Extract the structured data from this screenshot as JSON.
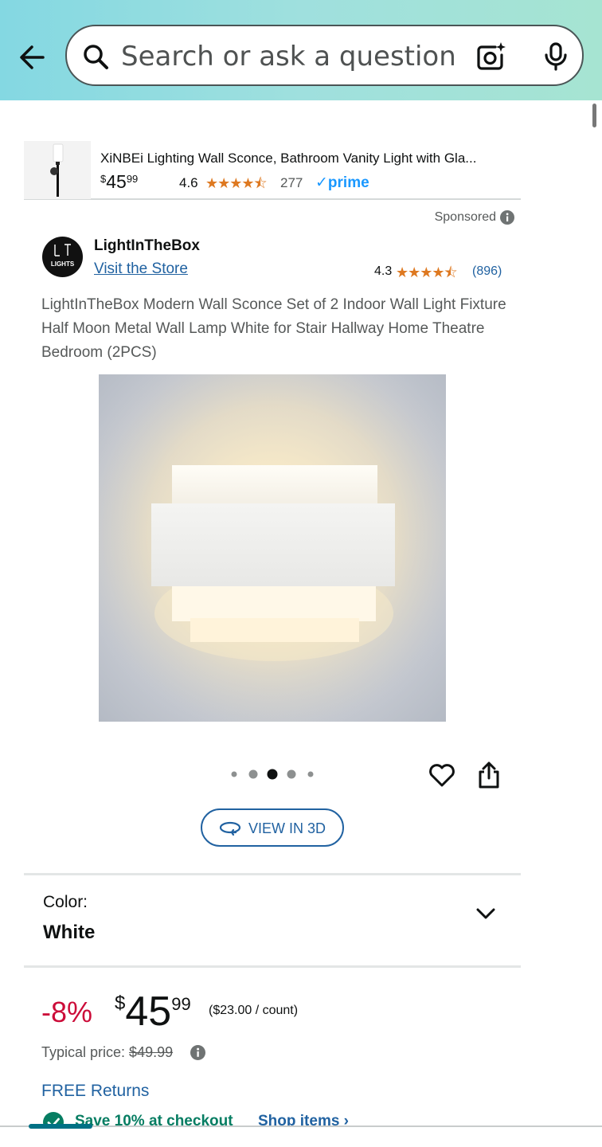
{
  "search": {
    "placeholder": "Search or ask a question"
  },
  "mini_product": {
    "title": "XiNBEi Lighting Wall Sconce, Bathroom Vanity Light with Gla...",
    "price_dollars": "45",
    "price_cents": "99",
    "price_symbol": "$",
    "rating": "4.6",
    "stars": "★★★★⯪",
    "rating_value": 4.6,
    "review_count": "277",
    "prime_label": "✓prime"
  },
  "sponsored_label": "Sponsored",
  "store": {
    "logo_text": "LIGHTS",
    "name": "LightInTheBox",
    "visit_label": "Visit the Store",
    "rating": "4.3",
    "stars": "★★★★⯪",
    "rating_value": 4.3,
    "review_count": "(896)"
  },
  "product": {
    "title": "LightInTheBox Modern Wall Sconce Set of 2 Indoor Wall Light Fixture Half Moon Metal Wall Lamp White for Stair Hallway Home Theatre Bedroom (2PCS)",
    "image_count": 5,
    "active_image_index": 2,
    "view_3d_label": "VIEW IN 3D"
  },
  "color": {
    "label": "Color:",
    "value": "White"
  },
  "pricing": {
    "discount": "-8%",
    "currency": "$",
    "dollars": "45",
    "cents": "99",
    "unit_price": "($23.00 / count)",
    "typical_label": "Typical price: ",
    "typical_value": "$49.99"
  },
  "returns_label": "FREE Returns",
  "checkout": {
    "save_text": "Save 10% at checkout",
    "shop_items": "Shop items ›"
  },
  "colors": {
    "accent_blue": "#2162a1",
    "star_orange": "#de7921",
    "discount_red": "#cc0c39",
    "savings_green": "#067d62"
  }
}
